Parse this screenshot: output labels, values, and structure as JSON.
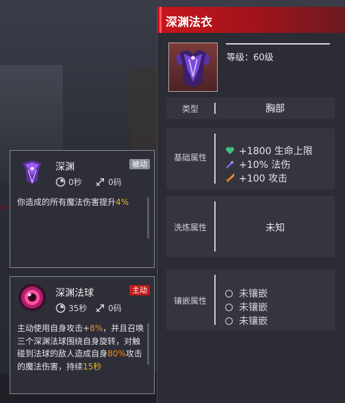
{
  "item": {
    "title": "深渊法衣",
    "level": "等级：60级",
    "type_label": "类型",
    "type_value": "胸部",
    "base_label": "基础属性",
    "base_attrs": [
      {
        "icon": "heart-icon",
        "text": "+1800 生命上限",
        "color": "#3fc07a"
      },
      {
        "icon": "magic-wand-icon",
        "text": "+10% 法伤",
        "color": "#9b6bff"
      },
      {
        "icon": "sword-icon",
        "text": "+100 攻击",
        "color": "#f08a2a"
      }
    ],
    "refine_label": "洗炼属性",
    "refine_value": "未知",
    "socket_label": "镶嵌属性",
    "sockets": [
      "未镶嵌",
      "未镶嵌",
      "未镶嵌"
    ]
  },
  "skills": [
    {
      "name": "深渊",
      "tag": "被动",
      "cooldown": "0秒",
      "range": "0码",
      "desc_parts": [
        "你造成的所有魔法伤害提升",
        "4%"
      ]
    },
    {
      "name": "深渊法球",
      "tag": "主动",
      "cooldown": "35秒",
      "range": "0码",
      "desc_parts": [
        "主动使用自身攻击+",
        "8%",
        "，并且召唤三个深渊法球围绕自身旋转，对触碰到法球的敌人造成自身",
        "80%",
        "攻击的魔法伤害，持续",
        "15秒"
      ]
    }
  ],
  "colors": {
    "accent": "#c8141c",
    "highlight": "#e8b431",
    "active_tag": "#c21a1a"
  }
}
